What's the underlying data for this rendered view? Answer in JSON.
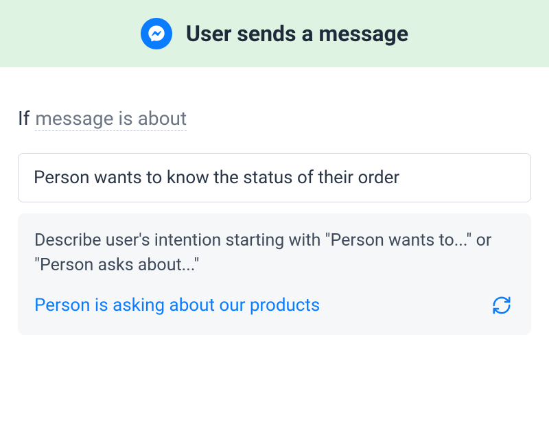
{
  "header": {
    "title": "User sends a message",
    "icon": "messenger-icon"
  },
  "condition": {
    "prefix": "If",
    "subject": "message is about"
  },
  "input": {
    "value": "Person wants to know the status of their order"
  },
  "hint": {
    "text": "Describe user's intention starting with \"Person wants to...\" or \"Person asks about...\""
  },
  "suggestion": {
    "text": "Person is asking about our products"
  },
  "colors": {
    "accent": "#0a7cff",
    "header_bg": "#dff3e3"
  }
}
